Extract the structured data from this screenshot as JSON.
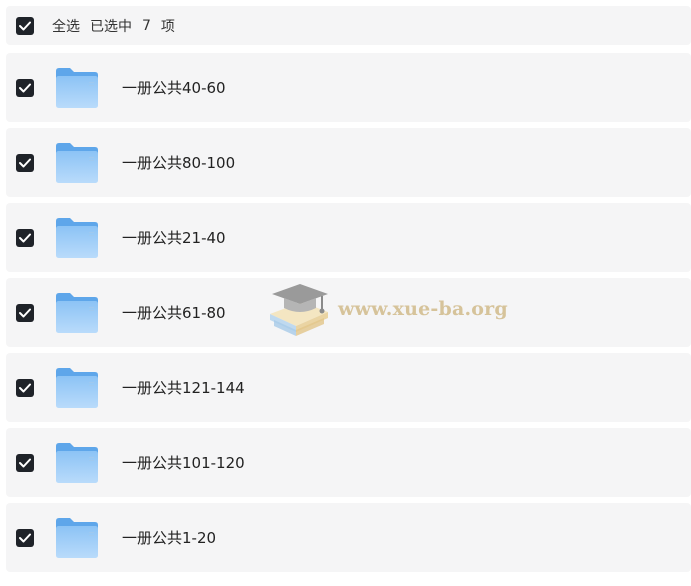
{
  "header": {
    "select_all_label": "全选",
    "selected_prefix": "已选中",
    "selected_count": "7",
    "selected_suffix": "项",
    "checked": true
  },
  "folders": [
    {
      "name": "一册公共40-60",
      "checked": true,
      "icon": "folder-icon"
    },
    {
      "name": "一册公共80-100",
      "checked": true,
      "icon": "folder-icon"
    },
    {
      "name": "一册公共21-40",
      "checked": true,
      "icon": "folder-icon"
    },
    {
      "name": "一册公共61-80",
      "checked": true,
      "icon": "folder-icon"
    },
    {
      "name": "一册公共121-144",
      "checked": true,
      "icon": "folder-icon"
    },
    {
      "name": "一册公共101-120",
      "checked": true,
      "icon": "folder-icon"
    },
    {
      "name": "一册公共1-20",
      "checked": true,
      "icon": "folder-icon"
    }
  ],
  "watermark": {
    "text": "www.xue-ba.org",
    "icon": "graduation-cap-books-icon"
  },
  "colors": {
    "row_background": "#f5f5f6",
    "checkbox_fill": "#1f2329",
    "folder_blue": "#7cb8f2",
    "watermark_text": "#d6c39a"
  }
}
